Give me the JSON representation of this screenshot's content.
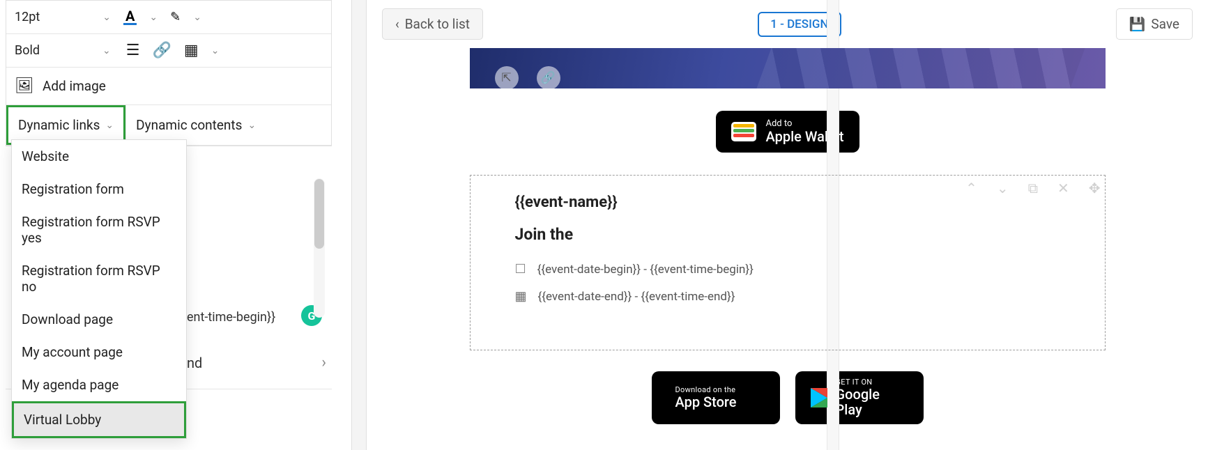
{
  "toolbar": {
    "font_size": "12pt",
    "font_weight": "Bold",
    "add_image_label": "Add image"
  },
  "dynamic": {
    "links_label": "Dynamic links",
    "contents_label": "Dynamic contents",
    "menu": [
      "Website",
      "Registration form",
      "Registration form RSVP yes",
      "Registration form RSVP no",
      "Download page",
      "My account page",
      "My agenda page",
      "Virtual Lobby"
    ]
  },
  "peek": {
    "time_begin": "ent-time-begin}}",
    "end_label": "nd"
  },
  "topbar": {
    "back_label": "Back to list",
    "design_badge": "1 - DESIGN",
    "save_label": "Save"
  },
  "wallet": {
    "line1": "Add to",
    "line2": "Apple Wallet"
  },
  "content": {
    "event_name": "{{event-name}}",
    "join_label": "Join the",
    "date_begin": "{{event-date-begin}} - {{event-time-begin}}",
    "date_end": "{{event-date-end}} - {{event-time-end}}"
  },
  "stores": {
    "apple_sm": "Download on the",
    "apple_lg": "App Store",
    "google_sm": "GET IT ON",
    "google_lg": "Google Play"
  }
}
